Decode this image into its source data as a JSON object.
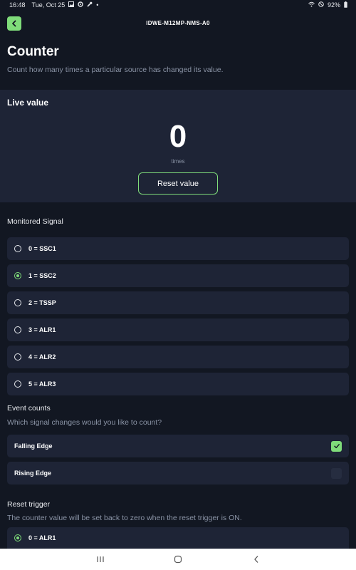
{
  "status_bar": {
    "time": "16:48",
    "date": "Tue, Oct 25",
    "battery": "92%"
  },
  "header": {
    "device_name": "IDWE-M12MP-NMS-A0"
  },
  "page": {
    "title": "Counter",
    "description": "Count how many times a particular source has changed its value."
  },
  "live": {
    "label": "Live value",
    "value": "0",
    "unit": "times",
    "reset_label": "Reset value"
  },
  "monitored": {
    "title": "Monitored Signal",
    "selected_index": 1,
    "options": [
      {
        "label": "0 = SSC1",
        "selected": false
      },
      {
        "label": "1 = SSC2",
        "selected": true
      },
      {
        "label": "2 = TSSP",
        "selected": false
      },
      {
        "label": "3 = ALR1",
        "selected": false
      },
      {
        "label": "4 = ALR2",
        "selected": false
      },
      {
        "label": "5 = ALR3",
        "selected": false
      }
    ]
  },
  "events": {
    "title": "Event counts",
    "description": "Which signal changes would you like to count?",
    "options": [
      {
        "label": "Falling Edge",
        "checked": true
      },
      {
        "label": "Rising Edge",
        "checked": false
      }
    ]
  },
  "reset_trigger": {
    "title": "Reset trigger",
    "description": "The counter value will be set back to zero when the reset trigger is ON.",
    "options": [
      {
        "label": "0 = ALR1",
        "selected": true
      }
    ]
  },
  "colors": {
    "accent": "#7fdc7a",
    "background": "#121722",
    "panel": "#1e2436"
  }
}
